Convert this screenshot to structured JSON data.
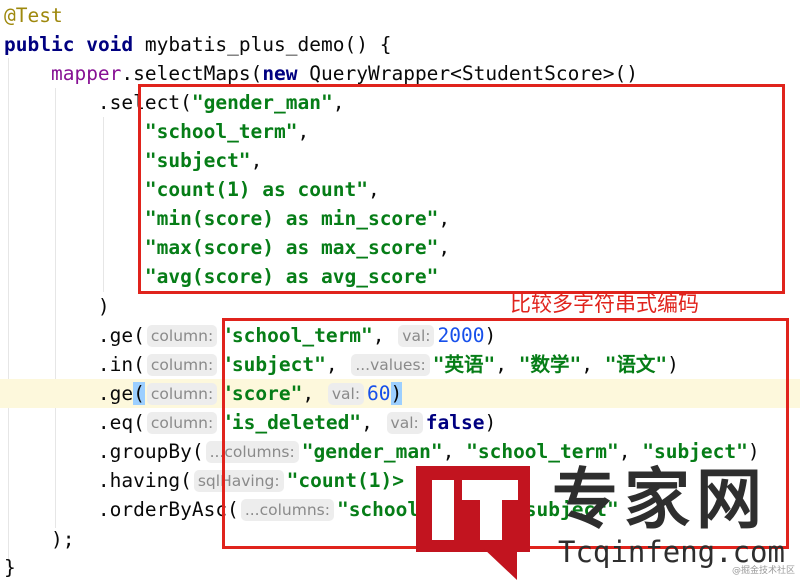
{
  "colors": {
    "keyword": "#000080",
    "string": "#067d17",
    "field": "#871094",
    "number": "#1750eb",
    "annotation": "#9e880d",
    "highlight_line": "#fdf8dc",
    "annotation_box": "#e0231c"
  },
  "code": [
    [
      {
        "t": "@Test",
        "c": "ann"
      }
    ],
    [
      {
        "t": "public",
        "c": "kw"
      },
      {
        "t": " "
      },
      {
        "t": "void",
        "c": "kw"
      },
      {
        "t": " mybatis_plus_demo() {"
      }
    ],
    [
      {
        "t": "    "
      },
      {
        "t": "mapper",
        "c": "fld"
      },
      {
        "t": ".selectMaps("
      },
      {
        "t": "new",
        "c": "kw"
      },
      {
        "t": " QueryWrapper<StudentScore>()"
      }
    ],
    [
      {
        "t": "        .select("
      },
      {
        "t": "\"gender_man\"",
        "c": "str"
      },
      {
        "t": ","
      }
    ],
    [
      {
        "t": "            "
      },
      {
        "t": "\"school_term\"",
        "c": "str"
      },
      {
        "t": ","
      }
    ],
    [
      {
        "t": "            "
      },
      {
        "t": "\"subject\"",
        "c": "str"
      },
      {
        "t": ","
      }
    ],
    [
      {
        "t": "            "
      },
      {
        "t": "\"count(1) as count\"",
        "c": "str"
      },
      {
        "t": ","
      }
    ],
    [
      {
        "t": "            "
      },
      {
        "t": "\"min(score) as min_score\"",
        "c": "str"
      },
      {
        "t": ","
      }
    ],
    [
      {
        "t": "            "
      },
      {
        "t": "\"max(score) as max_score\"",
        "c": "str"
      },
      {
        "t": ","
      }
    ],
    [
      {
        "t": "            "
      },
      {
        "t": "\"avg(score) as avg_score\"",
        "c": "str"
      }
    ],
    [
      {
        "t": "        )"
      }
    ],
    [
      {
        "t": "        .ge("
      },
      {
        "t": "column:",
        "c": "hint"
      },
      {
        "t": "\"school_term\"",
        "c": "str"
      },
      {
        "t": ", "
      },
      {
        "t": "val:",
        "c": "hint"
      },
      {
        "t": "2000",
        "c": "num"
      },
      {
        "t": ")"
      }
    ],
    [
      {
        "t": "        .in("
      },
      {
        "t": "column:",
        "c": "hint"
      },
      {
        "t": "\"subject\"",
        "c": "str"
      },
      {
        "t": ", "
      },
      {
        "t": "...values:",
        "c": "hint"
      },
      {
        "t": "\"英语\"",
        "c": "str"
      },
      {
        "t": ", "
      },
      {
        "t": "\"数学\"",
        "c": "str"
      },
      {
        "t": ", "
      },
      {
        "t": "\"语文\"",
        "c": "str"
      },
      {
        "t": ")"
      }
    ],
    [
      {
        "t": "        .ge"
      },
      {
        "t": "(",
        "c": "caret"
      },
      {
        "t": "column:",
        "c": "hint"
      },
      {
        "t": "\"score\"",
        "c": "str"
      },
      {
        "t": ", "
      },
      {
        "t": "val:",
        "c": "hint"
      },
      {
        "t": "60",
        "c": "num"
      },
      {
        "t": ")",
        "c": "caret"
      }
    ],
    [
      {
        "t": "        .eq("
      },
      {
        "t": "column:",
        "c": "hint"
      },
      {
        "t": "\"is_deleted\"",
        "c": "str"
      },
      {
        "t": ", "
      },
      {
        "t": "val:",
        "c": "hint"
      },
      {
        "t": "false",
        "c": "kw"
      },
      {
        "t": ")"
      }
    ],
    [
      {
        "t": "        .groupBy("
      },
      {
        "t": "...columns:",
        "c": "hint"
      },
      {
        "t": "\"gender_man\"",
        "c": "str"
      },
      {
        "t": ", "
      },
      {
        "t": "\"school_term\"",
        "c": "str"
      },
      {
        "t": ", "
      },
      {
        "t": "\"subject\"",
        "c": "str"
      },
      {
        "t": ")"
      }
    ],
    [
      {
        "t": "        .having("
      },
      {
        "t": "sqlHaving:",
        "c": "hint"
      },
      {
        "t": "\"count(1)>",
        "c": "str"
      }
    ],
    [
      {
        "t": "        .orderByAsc("
      },
      {
        "t": "...columns:",
        "c": "hint"
      },
      {
        "t": "\"school_term\"",
        "c": "str"
      },
      {
        "t": ", "
      },
      {
        "t": "\"subject\"",
        "c": "str"
      }
    ],
    [
      {
        "t": "    );"
      }
    ],
    [
      {
        "t": "}"
      }
    ]
  ],
  "annotation_label": "比较多字符串式编码",
  "watermark": {
    "logo": "IT",
    "name": "专家网",
    "url": "Tcqinfeng.com",
    "source": "@掘金技术社区"
  }
}
